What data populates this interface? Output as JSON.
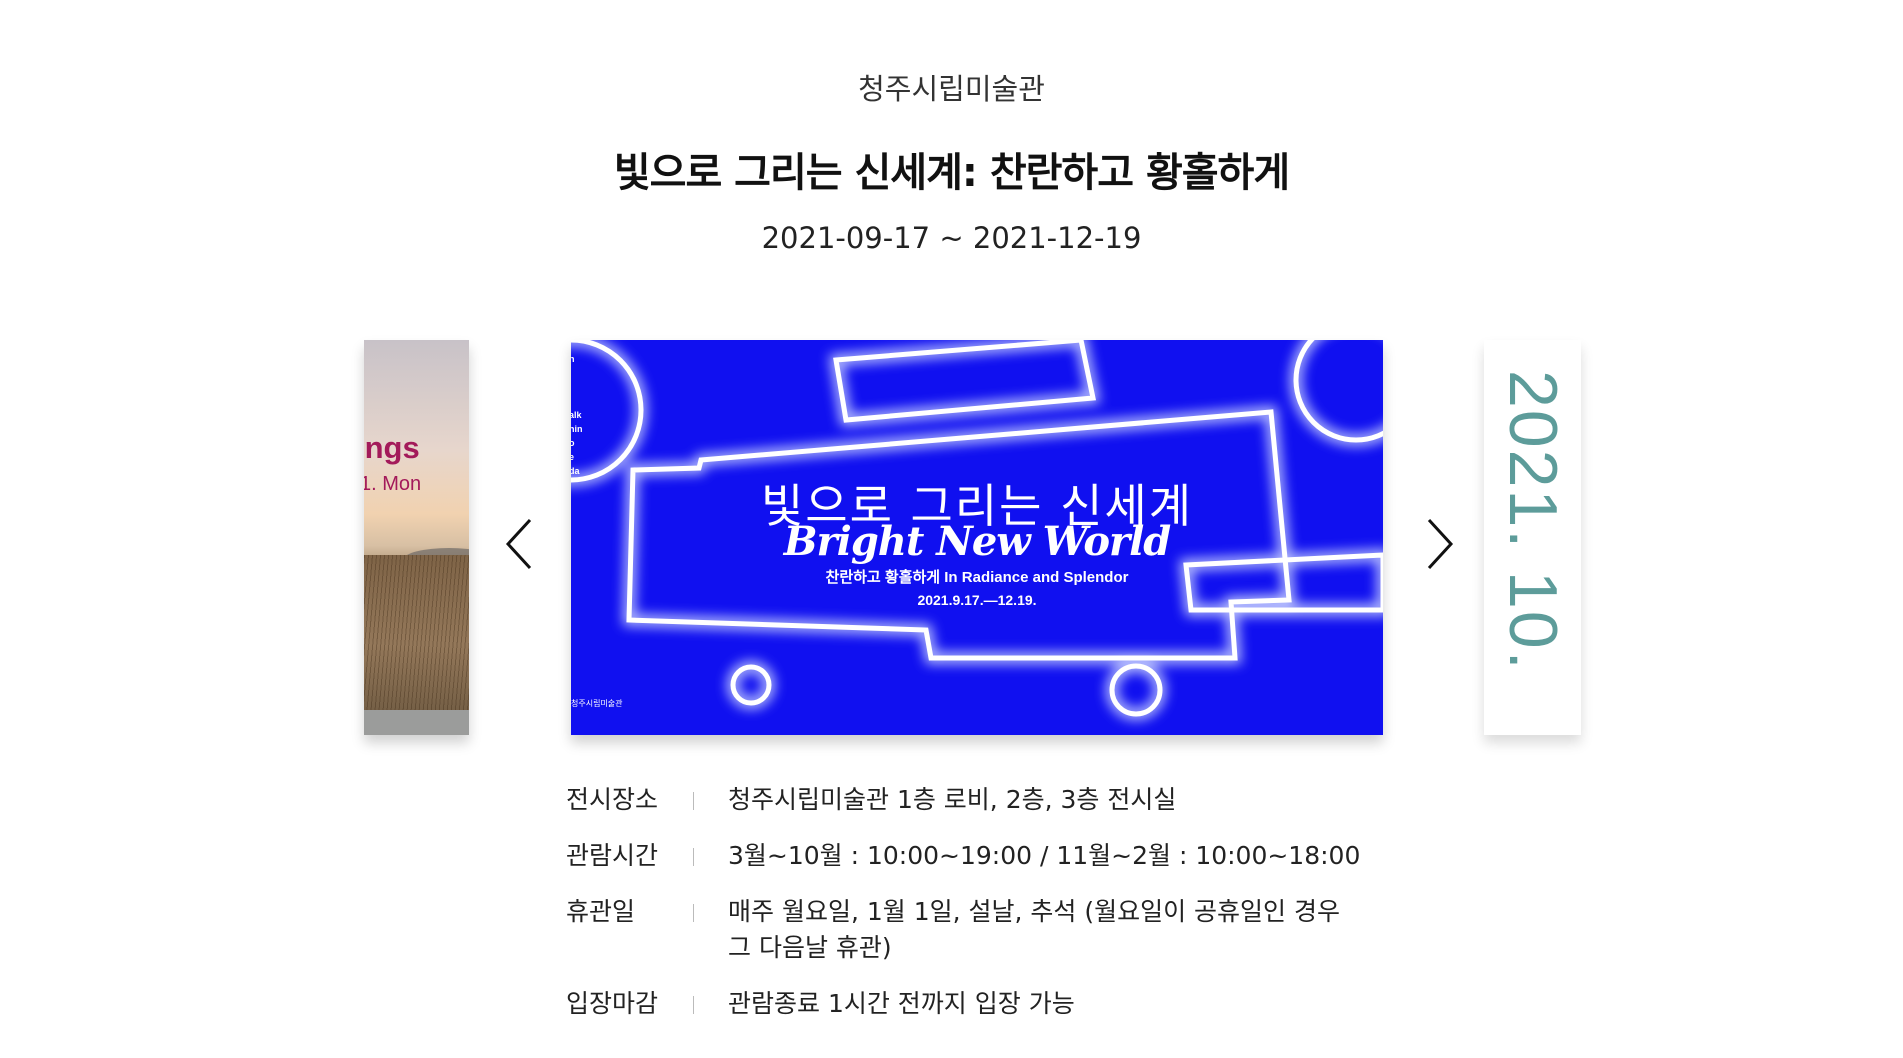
{
  "exhibition": {
    "museum": "청주시립미술관",
    "title": "빛으로 그리는 신세계: 찬란하고 황홀하게",
    "period": "2021-09-17 ~ 2021-12-19"
  },
  "carousel": {
    "prev_slide": {
      "title_fragment": "ings",
      "date_fragment": "1. Mon"
    },
    "main_slide": {
      "title_ko": "빛으로 그리는 신세계",
      "title_en": "Bright New World",
      "subtitle": "찬란하고 황홀하게 In Radiance and Splendor",
      "dates": "2021.9.17.—12.19.",
      "side_text": "n\n\nalk\nhin\no\ne\nda",
      "logo_text": "청주시립미술관"
    },
    "next_slide": {
      "vertical_text": "2021. 10."
    },
    "prev_button": "chevron-left-icon",
    "next_button": "chevron-right-icon"
  },
  "info": [
    {
      "label": "전시장소",
      "value": "청주시립미술관 1층 로비, 2층, 3층 전시실"
    },
    {
      "label": "관람시간",
      "value": "3월~10월 : 10:00~19:00 / 11월~2월 : 10:00~18:00"
    },
    {
      "label": "휴관일",
      "value": "매주 월요일, 1월 1일, 설날, 추석 (월요일이 공휴일인 경우 그 다음날 휴관)"
    },
    {
      "label": "입장마감",
      "value": "관람종료 1시간 전까지 입장 가능"
    }
  ],
  "colors": {
    "poster_blue": "#1010f0",
    "prev_accent": "#a31a5a",
    "next_accent": "#5d9c9a"
  }
}
